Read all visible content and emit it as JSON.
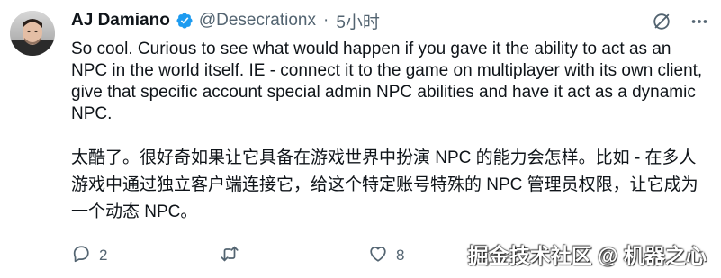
{
  "tweet": {
    "author_name": "AJ Damiano",
    "handle": "@Desecrationx",
    "separator": "·",
    "time": "5小时",
    "text_en": "So cool. Curious to see what would happen if you gave it the ability to act as an NPC in the world itself. IE - connect it to the game on multiplayer with its own client, give that specific account special admin NPC abilities and have it act as a dynamic NPC.",
    "text_zh": "太酷了。很好奇如果让它具备在游戏世界中扮演 NPC 的能力会怎样。比如 - 在多人游戏中通过独立客户端连接它，给这个特定账号特殊的 NPC 管理员权限，让它成为一个动态 NPC。",
    "reply_count": "2",
    "retweet_count": "",
    "like_count": "8"
  },
  "icons": {
    "verified": "verified-badge-icon",
    "grok": "grok-icon",
    "more": "more-icon",
    "reply": "reply-icon",
    "retweet": "retweet-icon",
    "like": "like-icon"
  },
  "colors": {
    "text": "#0f1419",
    "secondary": "#536471",
    "verified": "#1d9bf0"
  },
  "watermark": "掘金技术社区 @ 机器之心"
}
